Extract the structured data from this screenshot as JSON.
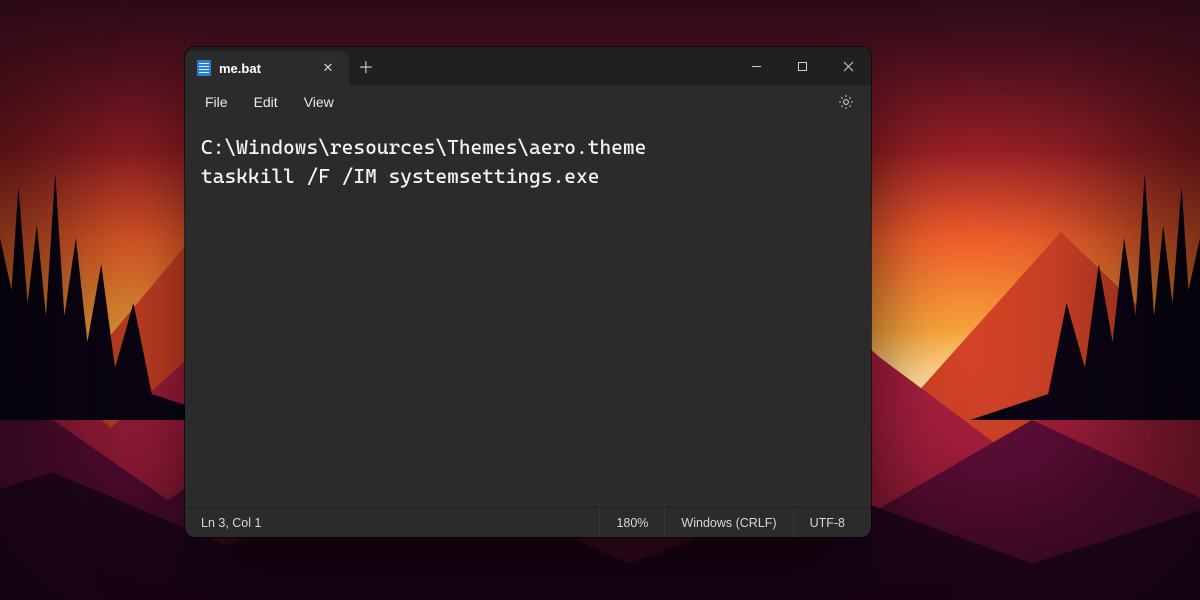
{
  "tab": {
    "title": "me.bat"
  },
  "menu": {
    "file": "File",
    "edit": "Edit",
    "view": "View"
  },
  "editor": {
    "content": "C:\\Windows\\resources\\Themes\\aero.theme\ntaskkill /F /IM systemsettings.exe"
  },
  "status": {
    "position": "Ln 3, Col 1",
    "zoom": "180%",
    "eol": "Windows (CRLF)",
    "encoding": "UTF-8"
  },
  "icons": {
    "close_tab": "✕",
    "new_tab": "＋"
  }
}
